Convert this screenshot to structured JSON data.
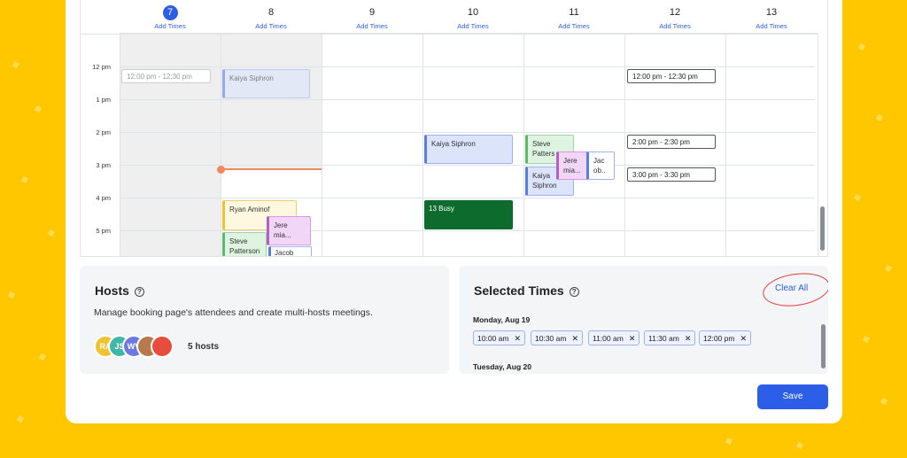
{
  "calendar": {
    "days": [
      {
        "num": "7",
        "add": "Add Times"
      },
      {
        "num": "8",
        "add": "Add Times"
      },
      {
        "num": "9",
        "add": "Add Times"
      },
      {
        "num": "10",
        "add": "Add Times"
      },
      {
        "num": "11",
        "add": "Add Times"
      },
      {
        "num": "12",
        "add": "Add Times"
      },
      {
        "num": "13",
        "add": "Add Times"
      }
    ],
    "times": [
      "12 pm",
      "1 pm",
      "2 pm",
      "3 pm",
      "4 pm",
      "5 pm"
    ],
    "events": {
      "d7_slot": "12:00 pm - 12:30 pm",
      "d8_kaiya": "Kaiya Siphron",
      "d8_ryan": "Ryan Aminof",
      "d8_jere": "Jere mia...",
      "d8_steve": "Steve Patterson",
      "d8_jacob": "Jacob",
      "d10_kaiya": "Kaiya Siphron",
      "d10_busy": "13 Busy",
      "d11_steve": "Steve Patters",
      "d11_jere": "Jere mia...",
      "d11_jacob": "Jac ob..",
      "d11_kaiya": "Kaiya Siphron",
      "d12_slot1": "12:00 pm - 12:30 pm",
      "d12_slot2": "2:00 pm - 2:30 pm",
      "d12_slot3": "3:00 pm - 3:30 pm"
    }
  },
  "hosts": {
    "title": "Hosts",
    "help_icon": "?",
    "description": "Manage booking page's attendees and create multi-hosts meetings.",
    "avatars": [
      "RA",
      "JS",
      "WV",
      "",
      ""
    ],
    "count": "5 hosts"
  },
  "selected": {
    "title": "Selected Times",
    "help_icon": "?",
    "clear_all": "Clear All",
    "date1": "Monday, Aug 19",
    "chips": [
      "10:00 am",
      "10:30 am",
      "11:00 am",
      "11:30 am",
      "12:00 pm"
    ],
    "chip_x": "✕",
    "date2": "Tuesday, Aug 20"
  },
  "save_label": "Save",
  "colors": {
    "accent": "#2d5ee8",
    "background": "#FFC700",
    "busy": "#0d6b2e",
    "now": "#f08a5d"
  }
}
